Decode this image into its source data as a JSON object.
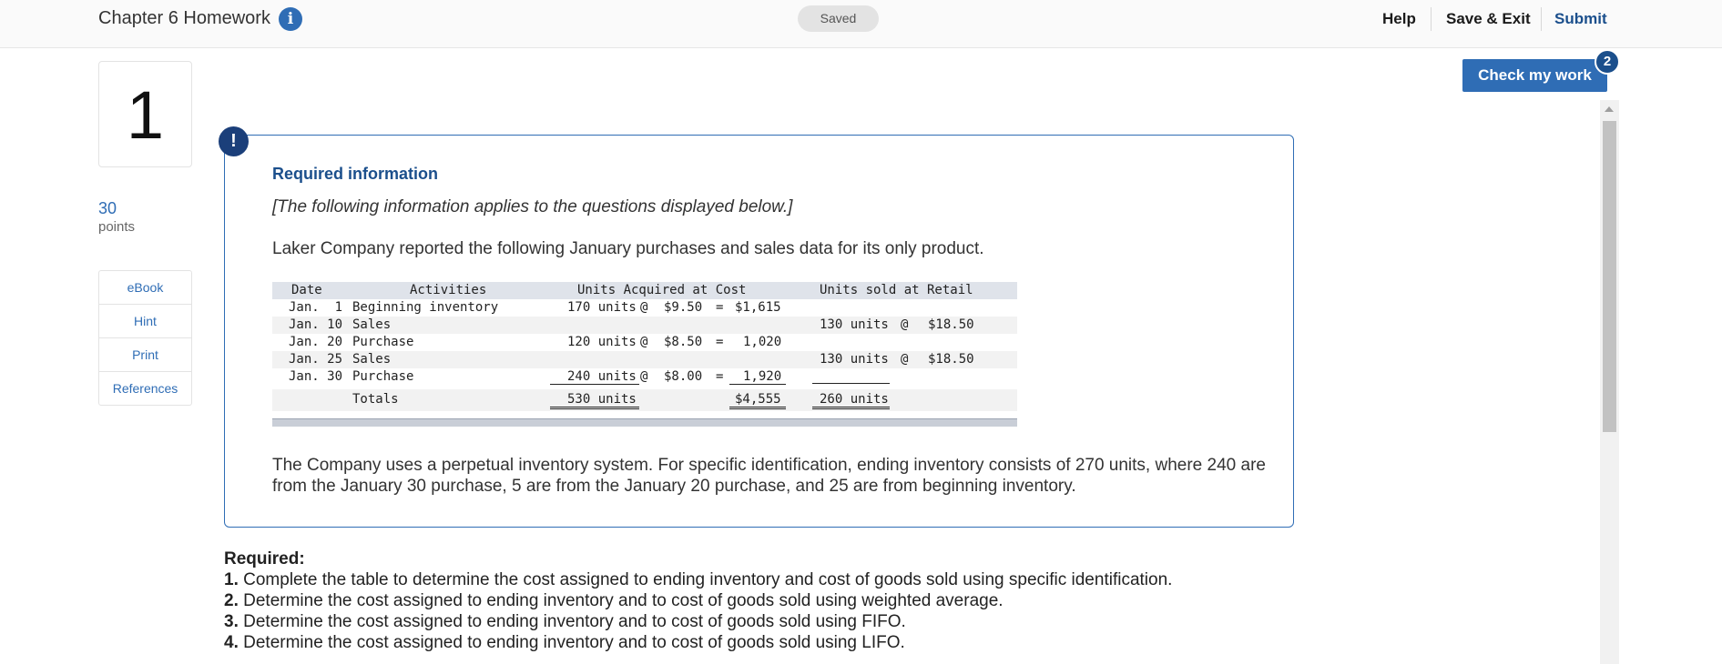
{
  "header": {
    "title": "Chapter 6 Homework",
    "info_icon": "i",
    "saved_label": "Saved",
    "help_label": "Help",
    "save_exit_label": "Save & Exit",
    "submit_label": "Submit"
  },
  "check_work": {
    "label": "Check my work",
    "badge": "2"
  },
  "question": {
    "number": "1",
    "points_value": "30",
    "points_label": "points"
  },
  "resources": [
    {
      "label": "eBook"
    },
    {
      "label": "Hint"
    },
    {
      "label": "Print"
    },
    {
      "label": "References"
    }
  ],
  "info": {
    "alert_icon": "!",
    "heading": "Required information",
    "note": "[The following information applies to the questions displayed below.]",
    "intro": "Laker Company reported the following January purchases and sales data for its only product.",
    "perpetual": "The Company uses a perpetual inventory system. For specific identification, ending inventory consists of 270 units, where 240 are from the January 30 purchase, 5 are from the January 20 purchase, and 25 are from beginning inventory."
  },
  "table": {
    "headers": {
      "date": "Date",
      "activities": "Activities",
      "acquired": "Units Acquired at Cost",
      "sold": "Units sold at Retail"
    },
    "rows": [
      {
        "date": "Jan.  1",
        "activity": "Beginning inventory",
        "units": "170 units",
        "at": "@",
        "cost": "$9.50",
        "eq": "=",
        "total": "$1,615",
        "sold_units": "",
        "sold_at": "",
        "retail": ""
      },
      {
        "date": "Jan. 10",
        "activity": "Sales",
        "units": "",
        "at": "",
        "cost": "",
        "eq": "",
        "total": "",
        "sold_units": "130 units",
        "sold_at": "@",
        "retail": "$18.50"
      },
      {
        "date": "Jan. 20",
        "activity": "Purchase",
        "units": "120 units",
        "at": "@",
        "cost": "$8.50",
        "eq": "=",
        "total": "1,020",
        "sold_units": "",
        "sold_at": "",
        "retail": ""
      },
      {
        "date": "Jan. 25",
        "activity": "Sales",
        "units": "",
        "at": "",
        "cost": "",
        "eq": "",
        "total": "",
        "sold_units": "130 units",
        "sold_at": "@",
        "retail": "$18.50"
      },
      {
        "date": "Jan. 30",
        "activity": "Purchase",
        "units": "240 units",
        "at": "@",
        "cost": "$8.00",
        "eq": "=",
        "total": "1,920",
        "sold_units": "",
        "sold_at": "",
        "retail": ""
      }
    ],
    "totals": {
      "label": "Totals",
      "units": "530 units",
      "total": "$4,555",
      "sold_units": "260 units"
    }
  },
  "required": {
    "heading": "Required:",
    "items": [
      {
        "num": "1.",
        "text": " Complete the table to determine the cost assigned to ending inventory and cost of goods sold using specific identification."
      },
      {
        "num": "2.",
        "text": " Determine the cost assigned to ending inventory and to cost of goods sold using weighted average."
      },
      {
        "num": "3.",
        "text": " Determine the cost assigned to ending inventory and to cost of goods sold using FIFO."
      },
      {
        "num": "4.",
        "text": " Determine the cost assigned to ending inventory and to cost of goods sold using LIFO."
      }
    ]
  },
  "colors": {
    "accent": "#2f6db5",
    "dark_accent": "#1b4f8c",
    "table_header": "#dfe3ea"
  }
}
